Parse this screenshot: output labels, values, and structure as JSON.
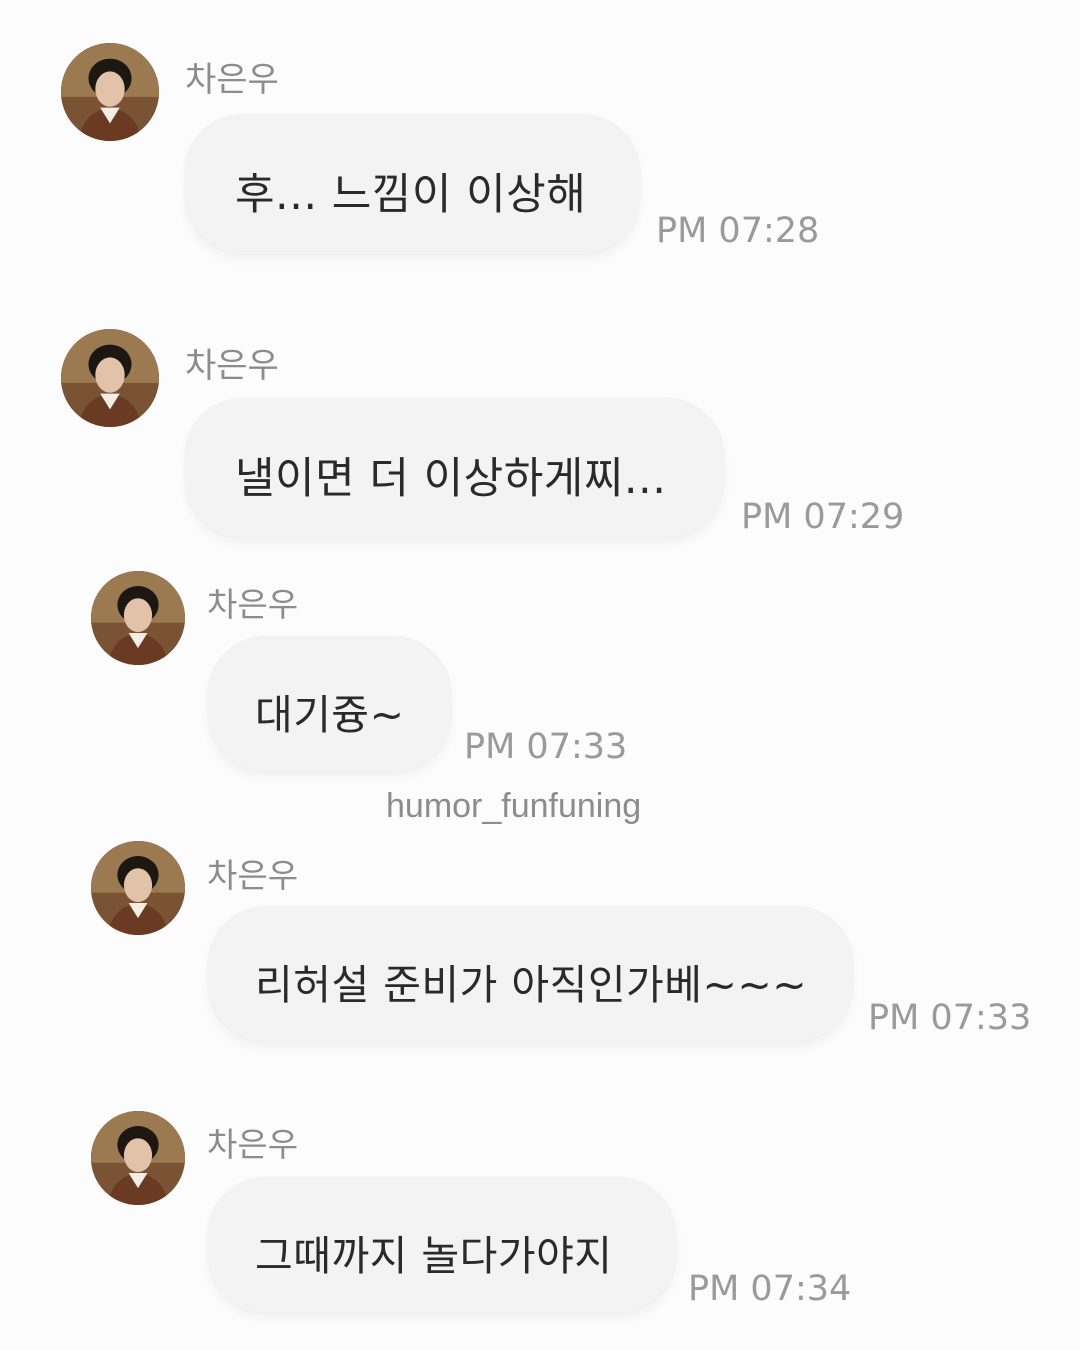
{
  "chat": {
    "messages": [
      {
        "sender": "차은우",
        "text": "후... 느낌이 이상해",
        "time": "PM 07:28"
      },
      {
        "sender": "차은우",
        "text": "낼이면 더 이상하게찌...",
        "time": "PM 07:29"
      },
      {
        "sender": "차은우",
        "text": "대기즁~",
        "time": "PM 07:33"
      },
      {
        "sender": "차은우",
        "text": "리허설 준비가 아직인가베~~~",
        "time": "PM 07:33"
      },
      {
        "sender": "차은우",
        "text": "그때까지 놀다가야지",
        "time": "PM 07:34"
      }
    ]
  },
  "watermark": "humor_funfuning",
  "colors": {
    "background": "#fdfcfd",
    "bubble": "#f3f3f3",
    "text": "#2a2a2a",
    "meta_text": "#9a9a9a"
  }
}
